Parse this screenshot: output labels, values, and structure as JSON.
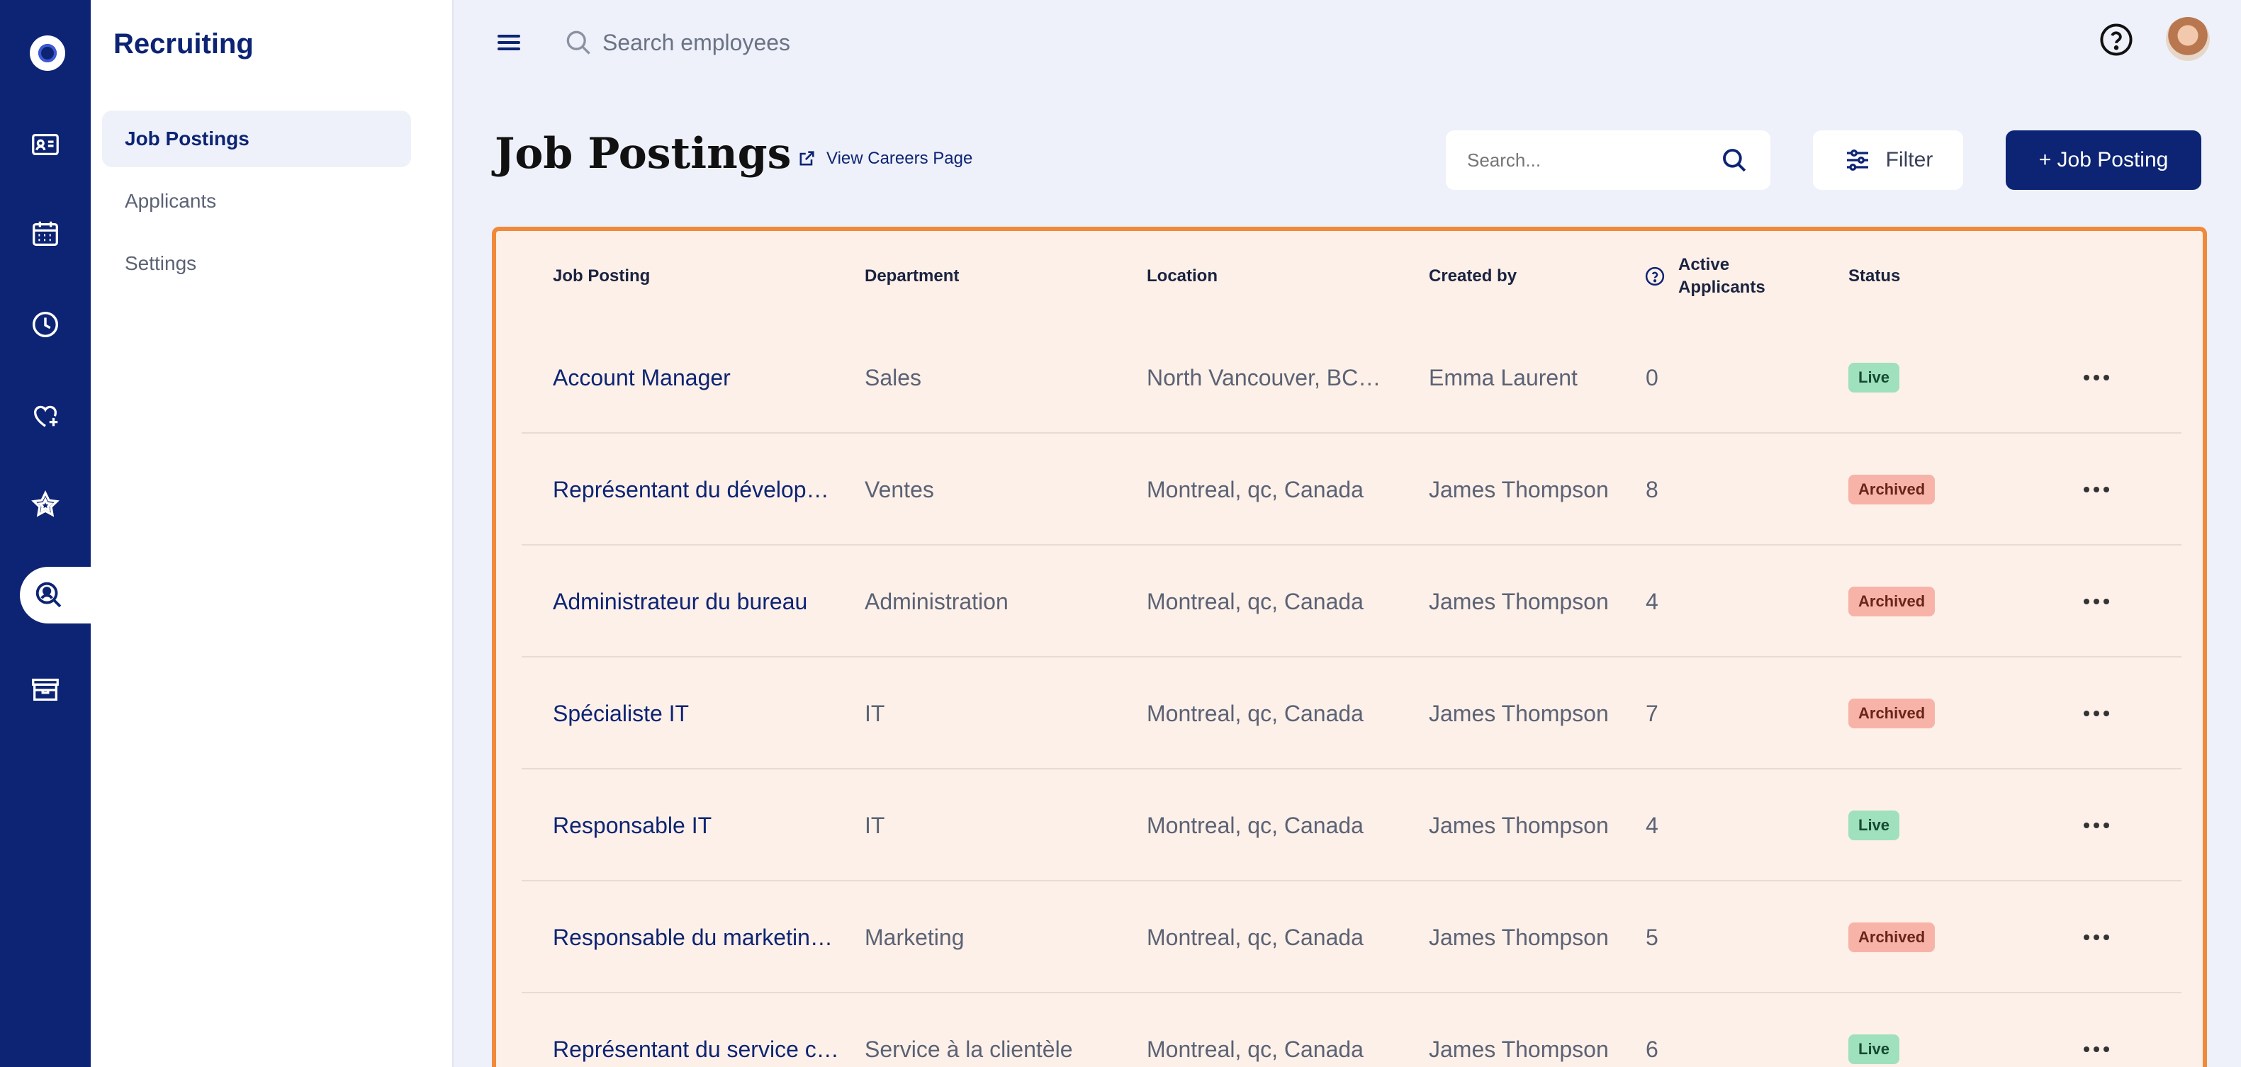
{
  "sidebar": {
    "title": "Recruiting",
    "items": [
      {
        "label": "Job Postings"
      },
      {
        "label": "Applicants"
      },
      {
        "label": "Settings"
      }
    ]
  },
  "rail": {
    "icons": [
      "logo-icon",
      "employee-card-icon",
      "calendar-icon",
      "clock-icon",
      "heart-plus-icon",
      "star-icon",
      "recruiting-search-icon",
      "box-icon"
    ],
    "active": "recruiting-search-icon"
  },
  "topbar": {
    "search_placeholder": "Search employees"
  },
  "page": {
    "title": "Job Postings",
    "careers_link": "View Careers Page",
    "search_placeholder": "Search...",
    "filter_label": "Filter",
    "add_label": "+ Job Posting"
  },
  "table": {
    "headers": {
      "job": "Job Posting",
      "department": "Department",
      "location": "Location",
      "created_by": "Created by",
      "active_line1": "Active",
      "active_line2": "Applicants",
      "status": "Status"
    },
    "rows": [
      {
        "job": "Account Manager",
        "department": "Sales",
        "location": "North Vancouver, BC…",
        "created_by": "Emma Laurent",
        "active": "0",
        "status": "Live"
      },
      {
        "job": "Représentant du dévelop…",
        "department": "Ventes",
        "location": "Montreal, qc, Canada",
        "created_by": "James Thompson",
        "active": "8",
        "status": "Archived"
      },
      {
        "job": "Administrateur du bureau",
        "department": "Administration",
        "location": "Montreal, qc, Canada",
        "created_by": "James Thompson",
        "active": "4",
        "status": "Archived"
      },
      {
        "job": "Spécialiste IT",
        "department": "IT",
        "location": "Montreal, qc, Canada",
        "created_by": "James Thompson",
        "active": "7",
        "status": "Archived"
      },
      {
        "job": "Responsable IT",
        "department": "IT",
        "location": "Montreal, qc, Canada",
        "created_by": "James Thompson",
        "active": "4",
        "status": "Live"
      },
      {
        "job": "Responsable du marketin…",
        "department": "Marketing",
        "location": "Montreal, qc, Canada",
        "created_by": "James Thompson",
        "active": "5",
        "status": "Archived"
      },
      {
        "job": "Représentant du service c…",
        "department": "Service à la clientèle",
        "location": "Montreal, qc, Canada",
        "created_by": "James Thompson",
        "active": "6",
        "status": "Live"
      }
    ]
  },
  "colors": {
    "brand": "#0d2474",
    "highlight_border": "#f0893a",
    "table_bg": "#fdf0e8",
    "live_badge": "#9fe0bd",
    "archived_badge": "#f7b3a8"
  }
}
